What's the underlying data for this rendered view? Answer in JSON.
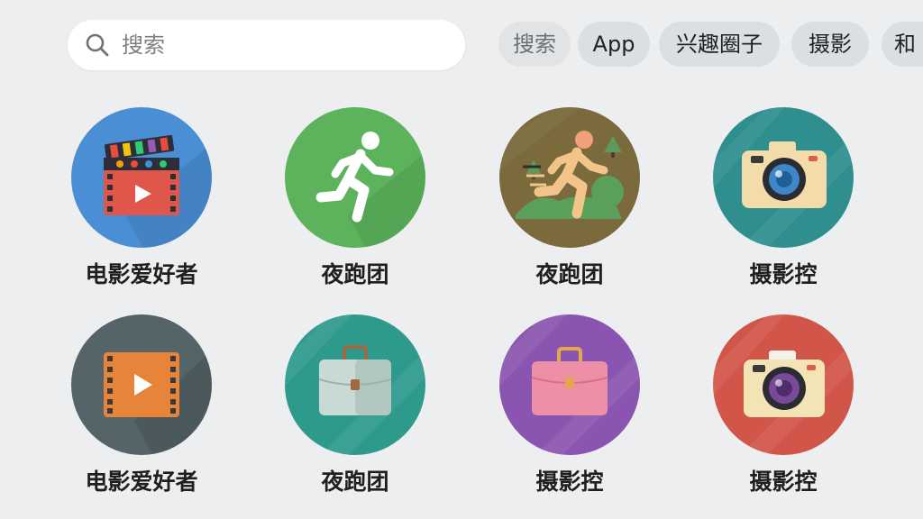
{
  "search": {
    "placeholder": "搜索"
  },
  "chips": [
    {
      "label": "搜索"
    },
    {
      "label": "App"
    },
    {
      "label": "兴趣圈子"
    },
    {
      "label": "摄影"
    },
    {
      "label": "和"
    }
  ],
  "tiles": [
    {
      "label": "电影爱好者",
      "icon": "film-clapper-icon",
      "color": "#4a8fd4"
    },
    {
      "label": "夜跑团",
      "icon": "runner-icon",
      "color": "#5cb35c"
    },
    {
      "label": "夜跑团",
      "icon": "trail-runner-icon",
      "color": "#7a6a3c"
    },
    {
      "label": "摄影控",
      "icon": "camera-icon",
      "color": "#2f8f8f"
    },
    {
      "label": "电影爱好者",
      "icon": "film-play-icon",
      "color": "#546468"
    },
    {
      "label": "夜跑团",
      "icon": "briefcase-icon",
      "color": "#2e9a8c"
    },
    {
      "label": "摄影控",
      "icon": "briefcase-icon",
      "color": "#8a55b0"
    },
    {
      "label": "摄影控",
      "icon": "camera-icon",
      "color": "#d2554a"
    }
  ]
}
